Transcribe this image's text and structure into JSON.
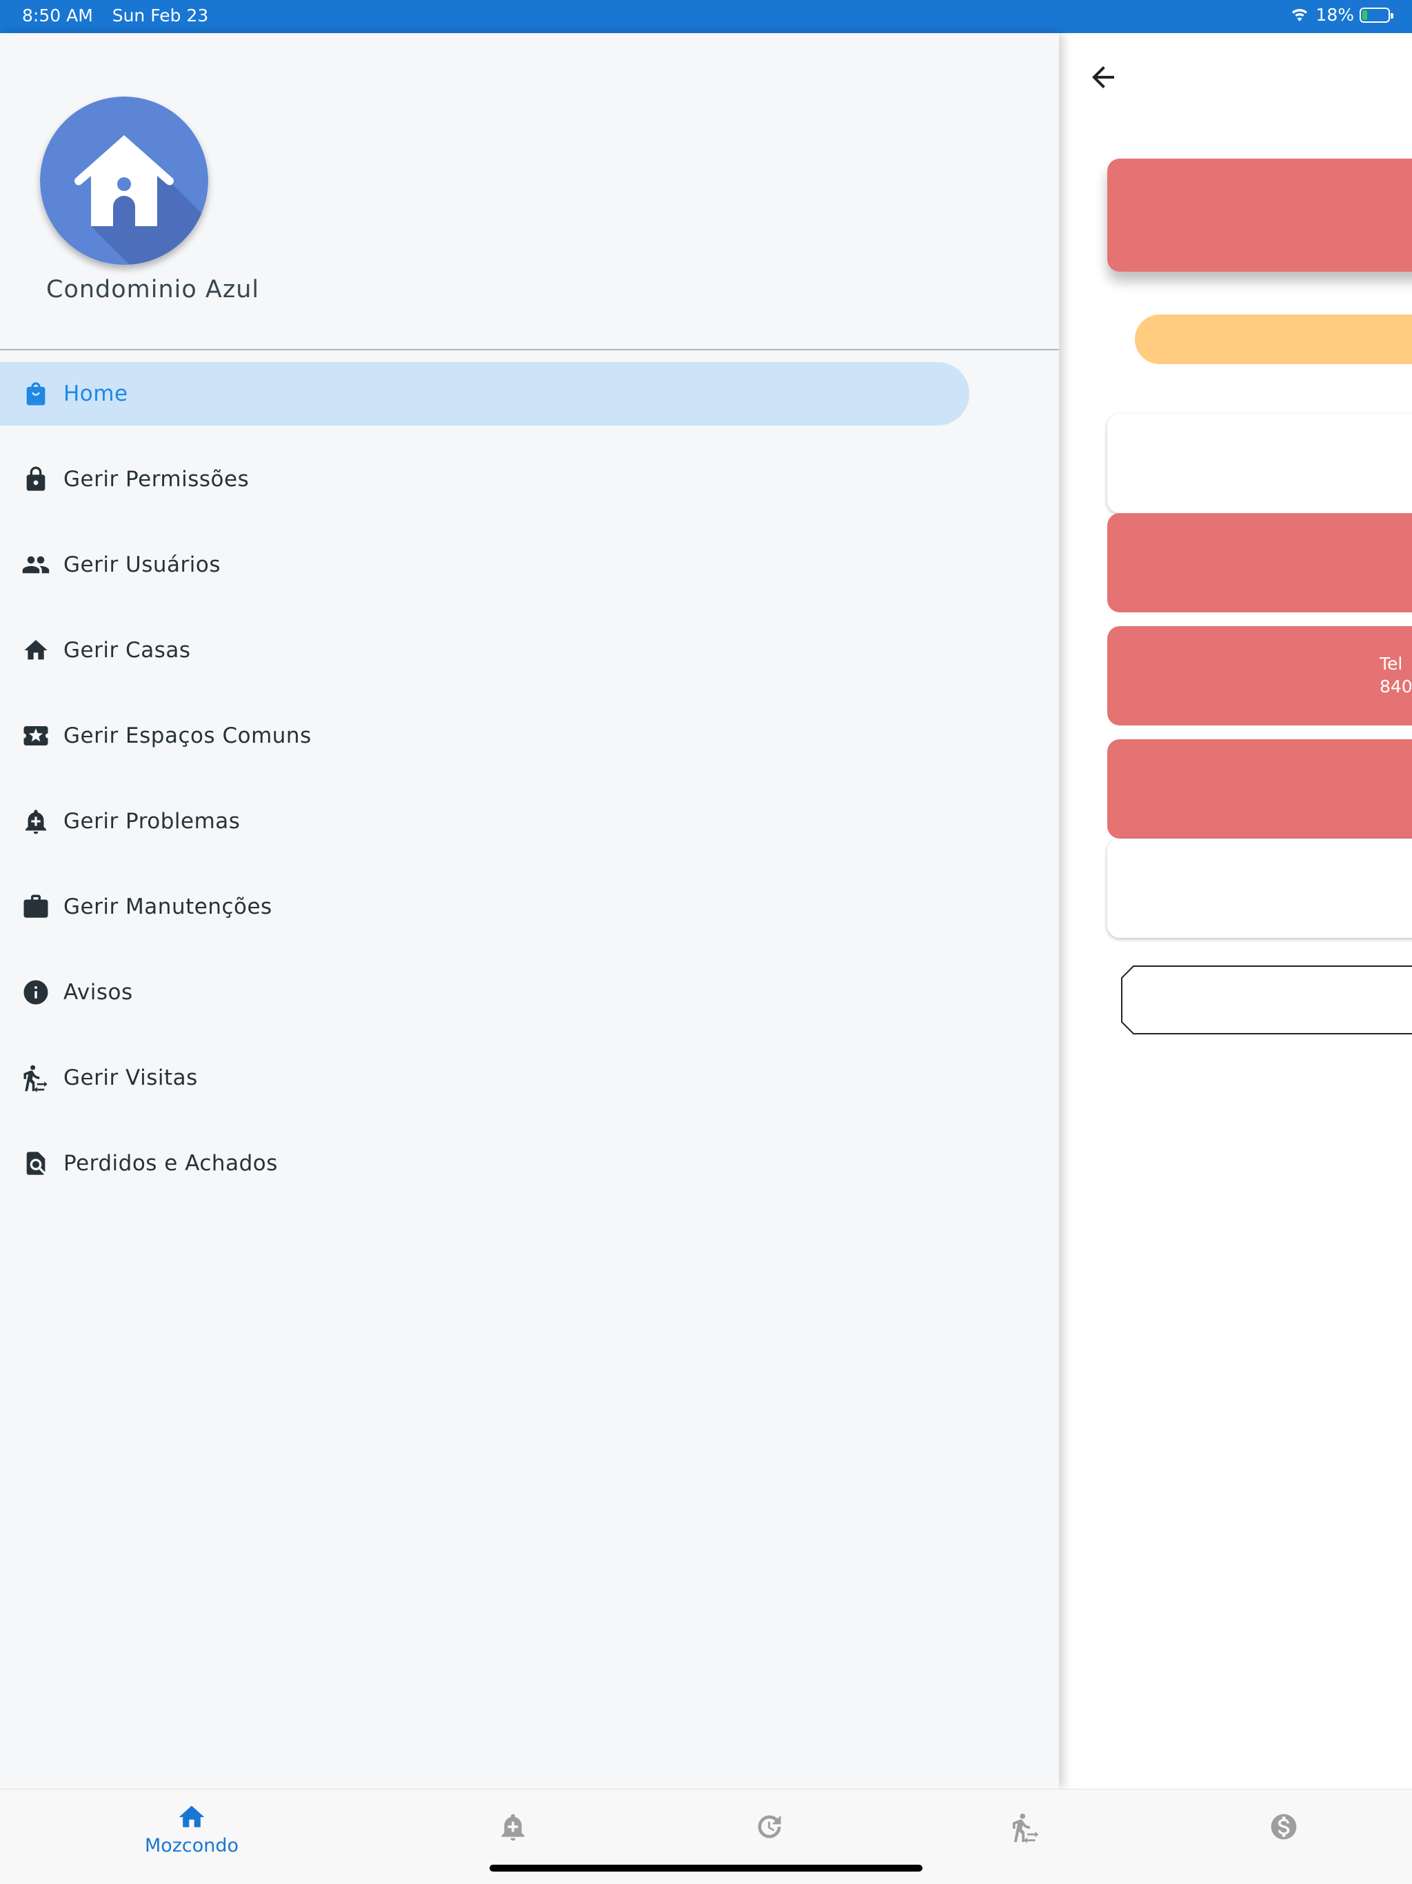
{
  "status_bar": {
    "time": "8:50 AM",
    "date": "Sun Feb 23",
    "battery": "18%",
    "battery_level": 0.18
  },
  "colors": {
    "status_bar": "#1976d2",
    "accent": "#1e88e5",
    "active_item_bg": "#cde3f8",
    "logo_circle": "#5c85d6",
    "card_red": "#e57373",
    "card_orange": "#ffcc80"
  },
  "drawer": {
    "brand_name": "Condominio Azul",
    "items": [
      {
        "label": "Home",
        "icon": "shopping-bag-icon",
        "active": true
      },
      {
        "label": "Gerir Permissões",
        "icon": "lock-icon"
      },
      {
        "label": "Gerir Usuários",
        "icon": "people-icon"
      },
      {
        "label": "Gerir Casas",
        "icon": "house-icon"
      },
      {
        "label": "Gerir Espaços Comuns",
        "icon": "star-ticket-icon"
      },
      {
        "label": "Gerir Problemas",
        "icon": "bell-plus-icon"
      },
      {
        "label": "Gerir Manutenções",
        "icon": "briefcase-icon"
      },
      {
        "label": "Avisos",
        "icon": "info-icon"
      },
      {
        "label": "Gerir Visitas",
        "icon": "visitor-icon"
      },
      {
        "label": "Perdidos e Achados",
        "icon": "document-search-icon"
      }
    ]
  },
  "content": {
    "back_icon": "arrow-back-icon",
    "card_text_line1": "Tel",
    "card_text_line2": "840"
  },
  "bottom_nav": {
    "items": [
      {
        "label": "Mozcondo",
        "icon": "home-icon",
        "active": true
      },
      {
        "label": "",
        "icon": "bell-plus-icon"
      },
      {
        "label": "",
        "icon": "history-icon"
      },
      {
        "label": "",
        "icon": "visitor-icon"
      },
      {
        "label": "",
        "icon": "dollar-icon"
      }
    ]
  }
}
